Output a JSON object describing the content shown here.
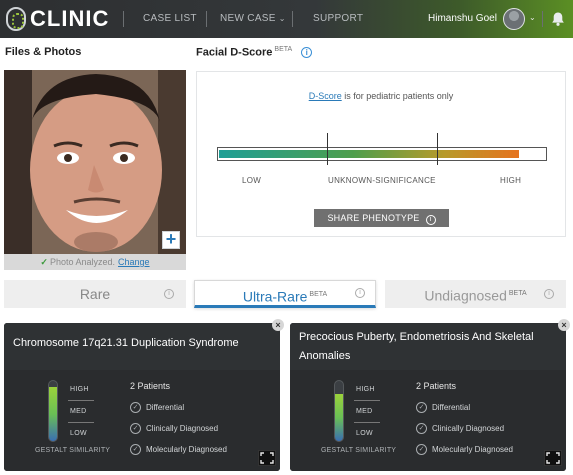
{
  "header": {
    "logo_text": "CLINIC",
    "nav": [
      {
        "label": "CASE LIST"
      },
      {
        "label": "NEW CASE"
      },
      {
        "label": "SUPPORT"
      }
    ],
    "user_name": "Himanshu Goel",
    "accent_color": "#5b8f24"
  },
  "files": {
    "title": "Files & Photos",
    "analyzed_text": "Photo Analyzed.",
    "change_link": "Change"
  },
  "dscore": {
    "title": "Facial D-Score",
    "beta": "BETA",
    "note_link": "D-Score",
    "note_rest": " is for pediatric patients only",
    "scale_fill": 0.92,
    "labels": {
      "low": "LOW",
      "unknown": "UNKNOWN-SIGNIFICANCE",
      "high": "HIGH"
    },
    "share_label": "SHARE PHENOTYPE"
  },
  "tabs": [
    {
      "label": "Rare",
      "beta": "",
      "active": false
    },
    {
      "label": "Ultra-Rare",
      "beta": "BETA",
      "active": true
    },
    {
      "label": "Undiagnosed",
      "beta": "BETA",
      "active": false
    }
  ],
  "cards": [
    {
      "title": "Chromosome 17q21.31 Duplication Syndrome",
      "gauge_level": 0.9,
      "levels": {
        "high": "HIGH",
        "med": "MED",
        "low": "LOW"
      },
      "gauge_caption": "GESTALT SIMILARITY",
      "patients": "2 Patients",
      "criteria": [
        "Differential",
        "Clinically Diagnosed",
        "Molecularly Diagnosed"
      ]
    },
    {
      "title": "Precocious Puberty, Endometriosis And Skeletal Anomalies",
      "gauge_level": 0.78,
      "levels": {
        "high": "HIGH",
        "med": "MED",
        "low": "LOW"
      },
      "gauge_caption": "GESTALT SIMILARITY",
      "patients": "2 Patients",
      "criteria": [
        "Differential",
        "Clinically Diagnosed",
        "Molecularly Diagnosed"
      ]
    }
  ]
}
